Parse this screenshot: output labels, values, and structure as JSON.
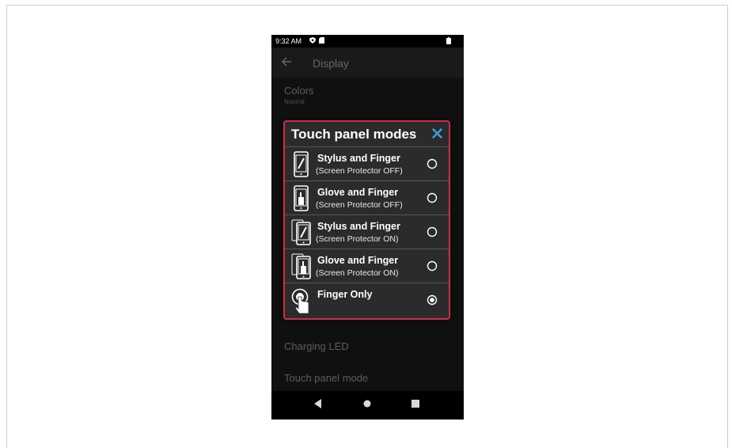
{
  "status_bar": {
    "time": "9:32 AM"
  },
  "app_bar": {
    "title": "Display"
  },
  "background_settings": [
    {
      "title": "Colors",
      "subtitle": "Natural"
    },
    {
      "title": "Charging LED"
    },
    {
      "title": "Touch panel mode"
    }
  ],
  "dialog": {
    "title": "Touch panel modes",
    "options": [
      {
        "label": "Stylus and Finger",
        "sublabel": "(Screen Protector OFF)",
        "icon": "stylus-finger-icon",
        "selected": false
      },
      {
        "label": "Glove and Finger",
        "sublabel": "(Screen Protector OFF)",
        "icon": "glove-finger-icon",
        "selected": false
      },
      {
        "label": "Stylus and Finger",
        "sublabel": "(Screen Protector ON)",
        "icon": "stylus-finger-protector-icon",
        "selected": false
      },
      {
        "label": "Glove and Finger",
        "sublabel": "(Screen Protector ON)",
        "icon": "glove-finger-protector-icon",
        "selected": false
      },
      {
        "label": "Finger Only",
        "sublabel": "",
        "icon": "finger-touch-icon",
        "selected": true
      }
    ]
  },
  "colors": {
    "accent": "#d42a4c",
    "close": "#3aa0e6",
    "dialog_bg": "#2b2b2b"
  }
}
